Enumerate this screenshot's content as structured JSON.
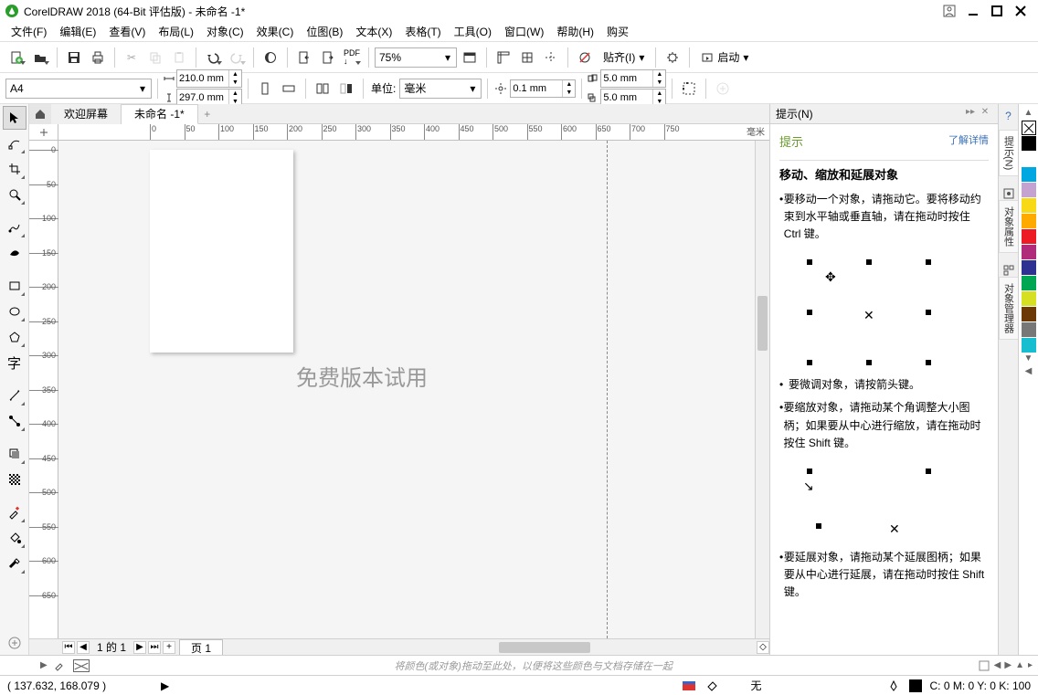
{
  "window": {
    "title": "CorelDRAW 2018 (64-Bit 评估版) - 未命名 -1*"
  },
  "menus": {
    "file": "文件(F)",
    "edit": "编辑(E)",
    "view": "查看(V)",
    "layout": "布局(L)",
    "object": "对象(C)",
    "effect": "效果(C)",
    "bitmap": "位图(B)",
    "text": "文本(X)",
    "table": "表格(T)",
    "tools": "工具(O)",
    "window": "窗口(W)",
    "help": "帮助(H)",
    "buy": "购买"
  },
  "toolbar": {
    "zoom": "75%",
    "snap_label": "贴齐(I)",
    "launch_label": "启动"
  },
  "propbar": {
    "paper": "A4",
    "width": "210.0 mm",
    "height": "297.0 mm",
    "unit_label": "单位:",
    "unit_value": "毫米",
    "nudge": "0.1 mm",
    "dup_x": "5.0 mm",
    "dup_y": "5.0 mm"
  },
  "doctabs": {
    "welcome": "欢迎屏幕",
    "current": "未命名 -1*"
  },
  "ruler": {
    "unit": "毫米",
    "ticks": [
      0,
      50,
      100,
      150,
      200,
      250,
      300,
      350,
      400,
      450,
      500,
      550,
      600,
      650,
      700,
      750
    ],
    "vticks": [
      0,
      50,
      100,
      150,
      200,
      250,
      300,
      350,
      400,
      450,
      500,
      550,
      600,
      650
    ]
  },
  "canvas": {
    "watermark": "免费版本试用"
  },
  "pager": {
    "info": "1 的 1",
    "page_tab": "页 1"
  },
  "hint": {
    "title_tab": "提示(N)",
    "heading": "提示",
    "learn_more": "了解详情",
    "section": "移动、缩放和延展对象",
    "b1": "要移动一个对象，请拖动它。要将移动约束到水平轴或垂直轴，请在拖动时按住 Ctrl 键。",
    "b2": "要微调对象，请按箭头键。",
    "b3": "要缩放对象，请拖动某个角调整大小图柄；如果要从中心进行缩放，请在拖动时按住 Shift 键。",
    "b4": "要延展对象，请拖动某个延展图柄；如果要从中心进行延展，请在拖动时按住 Shift 键。"
  },
  "right_tabs": {
    "t1": "提示(N)",
    "t2": "对象属性",
    "t3": "对象管理器"
  },
  "swatch_hint": "将颜色(或对象)拖动至此处，以便将这些颜色与文档存储在一起",
  "status": {
    "coords": "( 137.632, 168.079 )",
    "fill_none": "无",
    "color": "C: 0 M: 0 Y: 0 K: 100"
  },
  "palette": [
    "#000000",
    "#ffffff",
    "#00a7e1",
    "#c4a3d1",
    "#f7d917",
    "#ffaa00",
    "#ed1c24",
    "#b02b7a",
    "#2e3192",
    "#00a651",
    "#d7df23",
    "#6a3906",
    "#777777",
    "#17becf"
  ]
}
